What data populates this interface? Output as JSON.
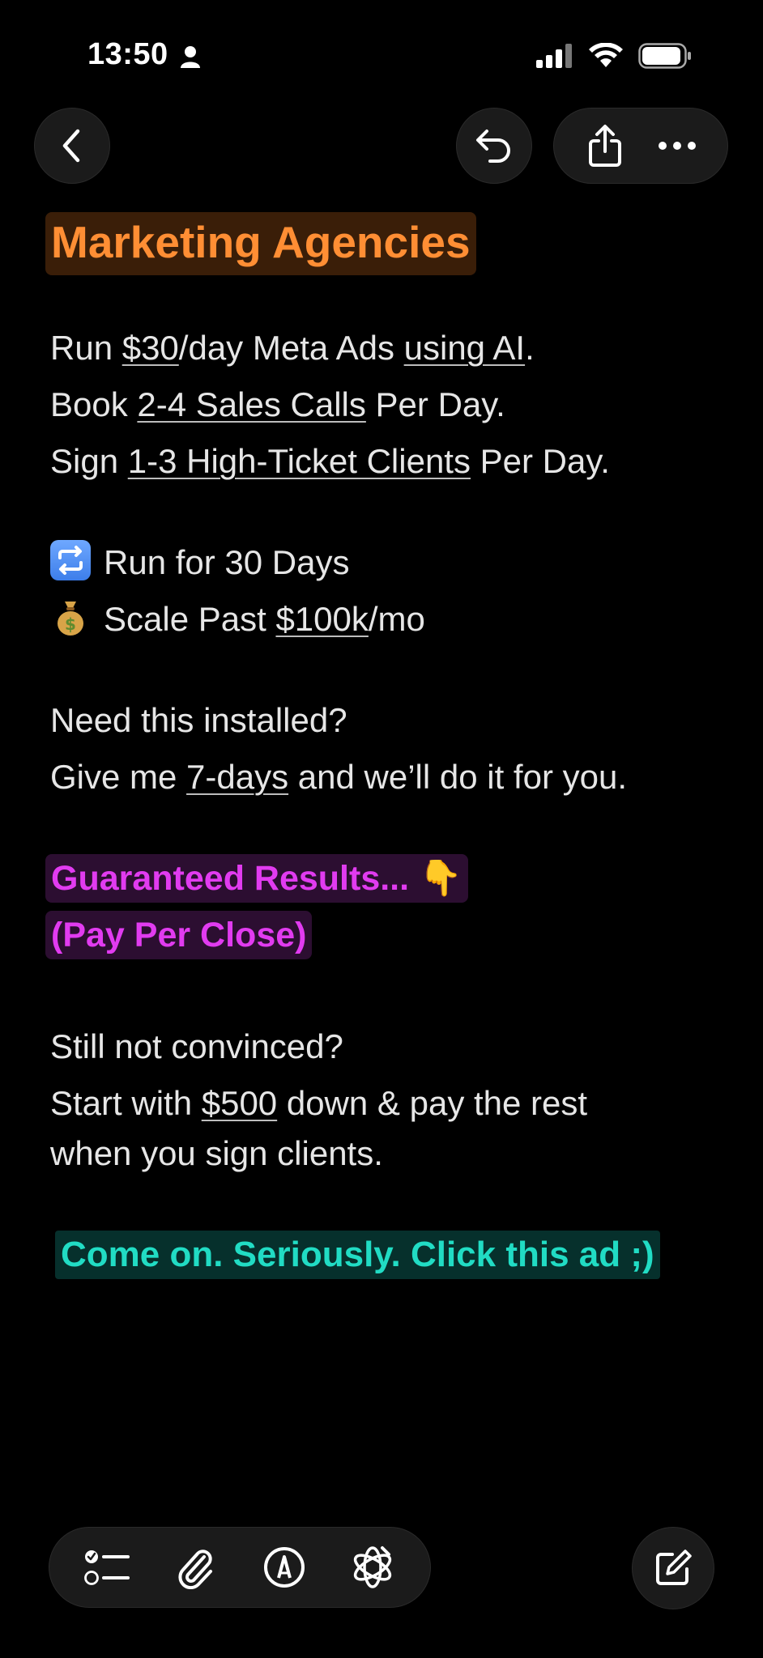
{
  "status_bar": {
    "time": "13:50"
  },
  "note": {
    "title": "Marketing Agencies",
    "line1": {
      "a": "Run ",
      "b": "$30",
      "c": "/day Meta Ads ",
      "d": "using AI",
      "e": "."
    },
    "line2": {
      "a": "Book ",
      "b": "2-4 Sales Calls",
      "c": " Per Day."
    },
    "line3": {
      "a": "Sign ",
      "b": "1-3 High-Ticket Clients",
      "c": " Per Day."
    },
    "bullet1": {
      "text": "Run for 30 Days"
    },
    "bullet2": {
      "a": "Scale Past ",
      "b": "$100k",
      "c": "/mo"
    },
    "line4": "Need this installed?",
    "line5": {
      "a": "Give me ",
      "b": "7-days",
      "c": " and we’ll do it for you."
    },
    "guarantee": "Guaranteed Results... 👇",
    "pay_per_close": "(Pay Per Close)",
    "line6": "Still not convinced?",
    "line7": {
      "a": "Start with ",
      "b": "$500",
      "c": " down & pay the rest"
    },
    "line8": "when you sign clients.",
    "cta": "Come on. Seriously. Click this ad ;)"
  },
  "icons": {
    "back": "chevron-left-icon",
    "undo": "undo-icon",
    "share": "share-icon",
    "more": "ellipsis-icon",
    "checklist": "checklist-icon",
    "attach": "paperclip-icon",
    "markup": "pen-circle-icon",
    "ai": "apple-intelligence-icon",
    "compose": "compose-icon"
  },
  "colors": {
    "background": "#000000",
    "title": "#FF8E34",
    "title_highlight": "#3A1E08",
    "purple": "#E13BF0",
    "purple_highlight": "#2C0E31",
    "teal": "#21DCC4",
    "teal_highlight": "#06302C",
    "button_bg": "#1B1B1B"
  }
}
